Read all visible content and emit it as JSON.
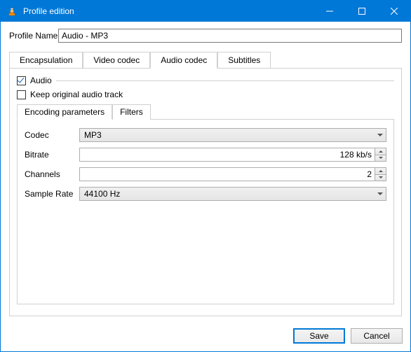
{
  "window": {
    "title": "Profile edition"
  },
  "profile_name": {
    "label": "Profile Name",
    "value": "Audio - MP3"
  },
  "tabs": {
    "encapsulation": "Encapsulation",
    "video_codec": "Video codec",
    "audio_codec": "Audio codec",
    "subtitles": "Subtitles",
    "active": "audio_codec"
  },
  "audio_panel": {
    "audio_checkbox": {
      "label": "Audio",
      "checked": true
    },
    "keep_original": {
      "label": "Keep original audio track",
      "checked": false
    },
    "inner_tabs": {
      "encoding": "Encoding parameters",
      "filters": "Filters",
      "active": "encoding"
    },
    "params": {
      "codec": {
        "label": "Codec",
        "value": "MP3"
      },
      "bitrate": {
        "label": "Bitrate",
        "value": "128 kb/s"
      },
      "channels": {
        "label": "Channels",
        "value": "2"
      },
      "samplerate": {
        "label": "Sample Rate",
        "value": "44100 Hz"
      }
    }
  },
  "buttons": {
    "save": "Save",
    "cancel": "Cancel"
  }
}
